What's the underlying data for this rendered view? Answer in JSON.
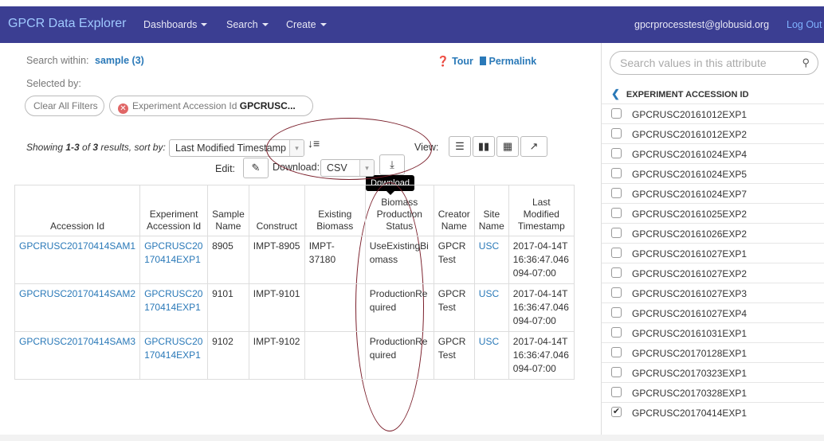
{
  "nav": {
    "brand": "GPCR Data Explorer",
    "menus": [
      "Dashboards",
      "Search",
      "Create"
    ],
    "user": "gpcrprocesstest@globusid.org",
    "logout": "Log Out"
  },
  "search_within": {
    "label": "Search within:",
    "value": "sample (3)"
  },
  "selected_by": "Selected by:",
  "clear_filters": "Clear All Filters",
  "filter": {
    "name": "Experiment Accession Id",
    "value": "GPCRUSC..."
  },
  "tour": "Tour",
  "permalink": "Permalink",
  "showing": {
    "prefix": "Showing ",
    "range": "1-3",
    "of": " of ",
    "count": "3",
    "suffix": " results, sort by:"
  },
  "sort_value": "Last Modified Timestamp",
  "view_label": "View:",
  "edit_label": "Edit:",
  "download_label": "Download:",
  "download_format": "CSV",
  "download_tooltip": "Download",
  "table": {
    "headers": [
      "Accession Id",
      "Experiment Accession Id",
      "Sample Name",
      "Construct",
      "Existing Biomass",
      "Biomass Production Status",
      "Creator Name",
      "Site Name",
      "Last Modified Timestamp"
    ],
    "rows": [
      [
        "GPCRUSC20170414SAM1",
        "GPCRUSC20 170414EXP1",
        "8905",
        "IMPT-8905",
        "IMPT-37180",
        "UseExistingBi omass",
        "GPCR Test",
        "USC",
        "2017-04-14T 16:36:47.046 094-07:00"
      ],
      [
        "GPCRUSC20170414SAM2",
        "GPCRUSC20 170414EXP1",
        "9101",
        "IMPT-9101",
        "",
        "ProductionRe quired",
        "GPCR Test",
        "USC",
        "2017-04-14T 16:36:47.046 094-07:00"
      ],
      [
        "GPCRUSC20170414SAM3",
        "GPCRUSC20 170414EXP1",
        "9102",
        "IMPT-9102",
        "",
        "ProductionRe quired",
        "GPCR Test",
        "USC",
        "2017-04-14T 16:36:47.046 094-07:00"
      ]
    ]
  },
  "sidebar": {
    "search_placeholder": "Search values in this attribute",
    "attribute": "EXPERIMENT ACCESSION ID",
    "items": [
      {
        "label": "GPCRUSC20161012EXP1",
        "checked": false
      },
      {
        "label": "GPCRUSC20161012EXP2",
        "checked": false
      },
      {
        "label": "GPCRUSC20161024EXP4",
        "checked": false
      },
      {
        "label": "GPCRUSC20161024EXP5",
        "checked": false
      },
      {
        "label": "GPCRUSC20161024EXP7",
        "checked": false
      },
      {
        "label": "GPCRUSC20161025EXP2",
        "checked": false
      },
      {
        "label": "GPCRUSC20161026EXP2",
        "checked": false
      },
      {
        "label": "GPCRUSC20161027EXP1",
        "checked": false
      },
      {
        "label": "GPCRUSC20161027EXP2",
        "checked": false
      },
      {
        "label": "GPCRUSC20161027EXP3",
        "checked": false
      },
      {
        "label": "GPCRUSC20161027EXP4",
        "checked": false
      },
      {
        "label": "GPCRUSC20161031EXP1",
        "checked": false
      },
      {
        "label": "GPCRUSC20170128EXP1",
        "checked": false
      },
      {
        "label": "GPCRUSC20170323EXP1",
        "checked": false
      },
      {
        "label": "GPCRUSC20170328EXP1",
        "checked": false
      },
      {
        "label": "GPCRUSC20170414EXP1",
        "checked": true
      }
    ]
  },
  "colors": {
    "navbar": "#3b3e92",
    "link": "#2a79b8",
    "annotation": "#7a1f2b"
  }
}
